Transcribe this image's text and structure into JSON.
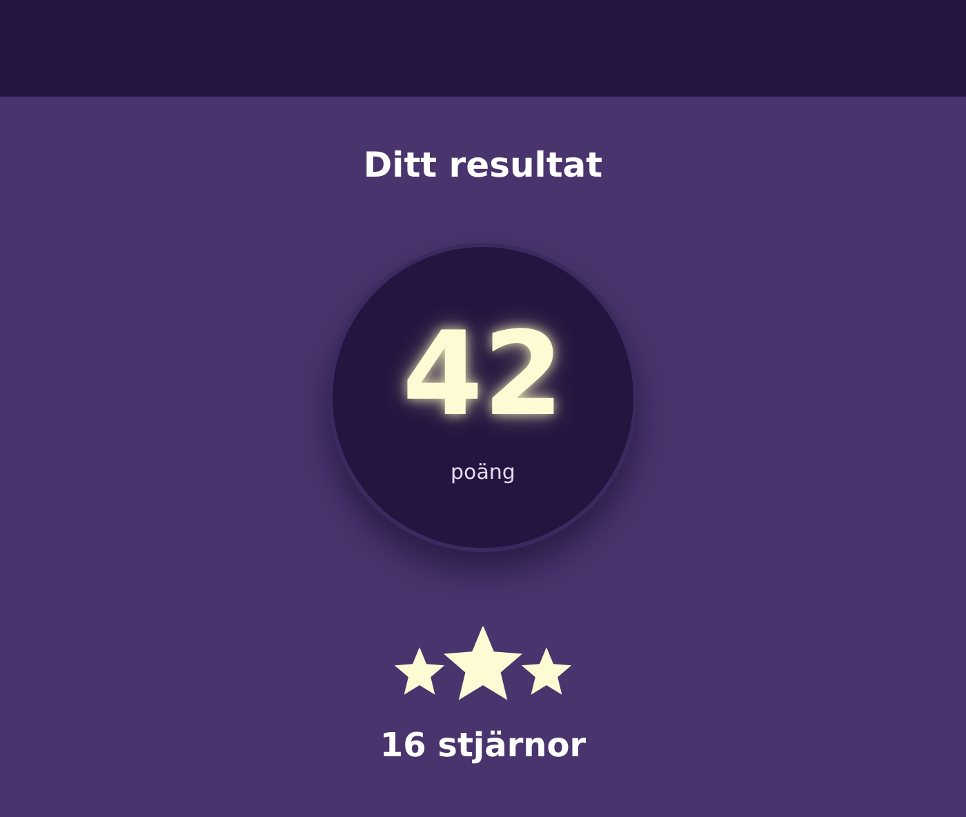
{
  "title": "Ditt resultat",
  "score": {
    "value": "42",
    "unit": "poäng"
  },
  "stars_label": "16 stjärnor"
}
